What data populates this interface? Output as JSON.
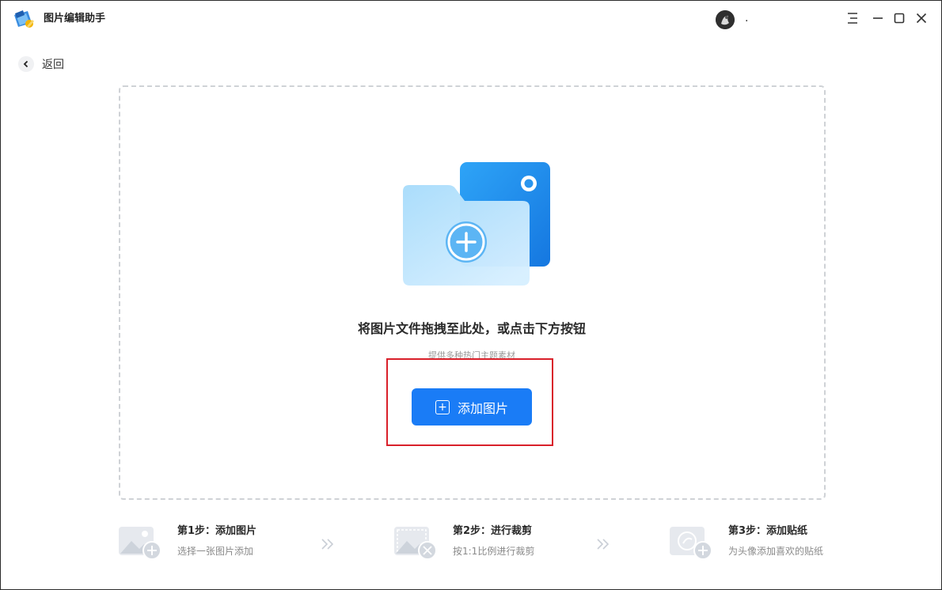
{
  "app": {
    "title": "图片编辑助手",
    "user_name": "."
  },
  "nav": {
    "back_label": "返回"
  },
  "dropzone": {
    "title": "将图片文件拖拽至此处，或点击下方按钮",
    "subtitle": "提供多种热门主题素材",
    "button_label": "添加图片"
  },
  "steps": [
    {
      "title": "第1步：添加图片",
      "desc": "选择一张图片添加",
      "icon": "add-image-icon"
    },
    {
      "title": "第2步：进行裁剪",
      "desc": "按1:1比例进行裁剪",
      "icon": "crop-image-icon"
    },
    {
      "title": "第3步：添加贴纸",
      "desc": "为头像添加喜欢的贴纸",
      "icon": "add-sticker-icon"
    }
  ],
  "colors": {
    "accent": "#1a7cf6",
    "highlight": "#d9202a",
    "folder": "#4fb3f3"
  }
}
